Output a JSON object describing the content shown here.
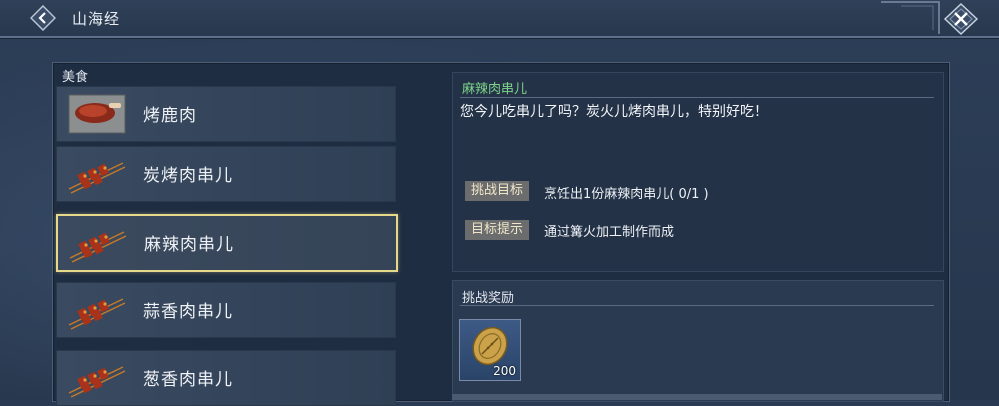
{
  "header": {
    "title": "山海经",
    "back_icon": "back-arrow-icon",
    "close_icon": "close-icon"
  },
  "category": {
    "label": "美食"
  },
  "list": {
    "items": [
      {
        "label": "烤鹿肉",
        "icon": "roast-venison-icon",
        "selected": false
      },
      {
        "label": "炭烤肉串儿",
        "icon": "meat-skewer-icon",
        "selected": false
      },
      {
        "label": "麻辣肉串儿",
        "icon": "meat-skewer-icon",
        "selected": true
      },
      {
        "label": "蒜香肉串儿",
        "icon": "meat-skewer-icon",
        "selected": false
      },
      {
        "label": "葱香肉串儿",
        "icon": "meat-skewer-icon",
        "selected": false
      }
    ]
  },
  "detail": {
    "title": "麻辣肉串儿",
    "description": "您今儿吃串儿了吗？炭火儿烤肉串儿，特别好吃！",
    "challenge_goal_label": "挑战目标",
    "challenge_goal_text": "烹饪出1份麻辣肉串儿( 0/1 )",
    "goal_hint_label": "目标提示",
    "goal_hint_text": "通过篝火加工制作而成"
  },
  "reward": {
    "title": "挑战奖励",
    "item_icon": "copper-coin-icon",
    "item_count": "200"
  },
  "colors": {
    "title_green": "#7fd48a",
    "selected_border": "#e6d98a",
    "tag_bg": "#6a6c6e"
  }
}
